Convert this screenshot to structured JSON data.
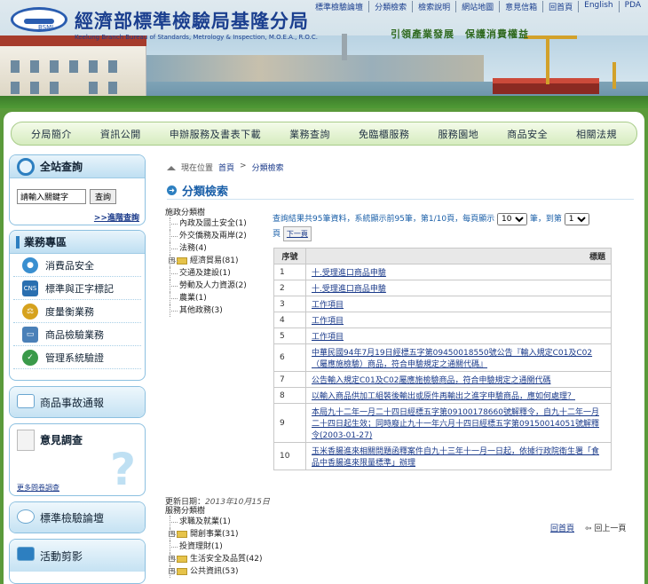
{
  "header": {
    "title": "經濟部標準檢驗局基隆分局",
    "subtitle": "Keelung Branch Bureau of Standards, Metrology & Inspection, M.O.E.A., R.O.C.",
    "logo_text": "BSMI",
    "slogan": "引領產業發展　保護消費權益"
  },
  "top_nav": [
    "標準檢驗論壇",
    "分類檢索",
    "檢索說明",
    "網站地圖",
    "意見信箱",
    "回首頁",
    "English",
    "PDA"
  ],
  "main_nav": [
    "分局簡介",
    "資訊公開",
    "申辦服務及書表下載",
    "業務查詢",
    "免臨櫃服務",
    "服務園地",
    "商品安全",
    "相關法規"
  ],
  "sidebar": {
    "search": {
      "title": "全站查詢",
      "placeholder": "請輸入關鍵字",
      "value": "請輸入關鍵字",
      "button": "查詢",
      "advanced": ">>進階查詢"
    },
    "business": {
      "title": "業務專區",
      "items": [
        {
          "label": "消費品安全",
          "icon": "lock-icon"
        },
        {
          "label": "標準與正字標記",
          "icon": "cns-icon"
        },
        {
          "label": "度量衡業務",
          "icon": "balance-icon"
        },
        {
          "label": "商品檢驗業務",
          "icon": "monitor-icon"
        },
        {
          "label": "管理系統驗證",
          "icon": "check-icon"
        }
      ]
    },
    "accident": "商品事故通報",
    "opinion": {
      "title": "意見調查",
      "more": "更多問卷調查"
    },
    "forum": "標準檢驗論壇",
    "activity": "活動剪影"
  },
  "breadcrumb": {
    "current": "現在位置",
    "home": "首頁",
    "sep": ">",
    "page": "分類檢索"
  },
  "page_title": "分類檢索",
  "tree1": {
    "caption": "施政分類樹",
    "nodes": [
      "內政及國土安全(1)",
      "外交僑務及兩岸(2)",
      "法務(4)",
      "經濟貿易(81)",
      "交通及建設(1)",
      "勞動及人力資源(2)",
      "農業(1)",
      "其他政務(3)"
    ]
  },
  "results": {
    "summary_pre": "查詢結果共95筆資料，系統顯示前95筆，第1/10頁，每頁顯示",
    "per_page": "10",
    "summary_mid": "筆，到第",
    "page": "1",
    "summary_post": "頁",
    "next": "下一頁",
    "headers": [
      "序號",
      "標題"
    ],
    "rows": [
      {
        "no": "1",
        "title": "十.受理進口商品申驗"
      },
      {
        "no": "2",
        "title": "十.受理進口商品申驗"
      },
      {
        "no": "3",
        "title": "工作項目"
      },
      {
        "no": "4",
        "title": "工作項目"
      },
      {
        "no": "5",
        "title": "工作項目"
      },
      {
        "no": "6",
        "title": "中華民國94年7月19日經標五字第09450018550號公告『輸入規定C01及C02（屬應施檢驗）商品，符合申驗規定之通關代碼』"
      },
      {
        "no": "7",
        "title": "公告輸入規定C01及C02屬應施檢驗商品，符合申驗規定之通關代碼"
      },
      {
        "no": "8",
        "title": "以輸入商品供加工組裝後輸出或原件再輸出之進字申驗商品，應如何處理？"
      },
      {
        "no": "9",
        "title": "本局九十二年一月二十四日經標五字第09100178660號解釋令，自九十二年一月二十四日起生效；同時廢止九十一年六月十四日經標五字第09150014051號解釋令(2003-01-27)"
      },
      {
        "no": "10",
        "title": "玉米香腸進來相關問題函釋案件自九十三年十一月一日起，依據行政院衛生署「食品中香腸進來限量標準」辦理"
      }
    ]
  },
  "update": {
    "label": "更新日期：",
    "date": "2013年10月15日"
  },
  "tree2": {
    "caption": "服務分類樹",
    "nodes": [
      "求職及就業(1)",
      "開創事業(31)",
      "投資理財(1)",
      "生活安全及品質(42)",
      "公共資訊(53)"
    ]
  },
  "pager": {
    "home": "回首頁",
    "back": "回上一頁"
  },
  "colors": {
    "brand_blue": "#1b3f8f",
    "link": "#1a3a8a",
    "accent_green": "#4f9a36"
  }
}
